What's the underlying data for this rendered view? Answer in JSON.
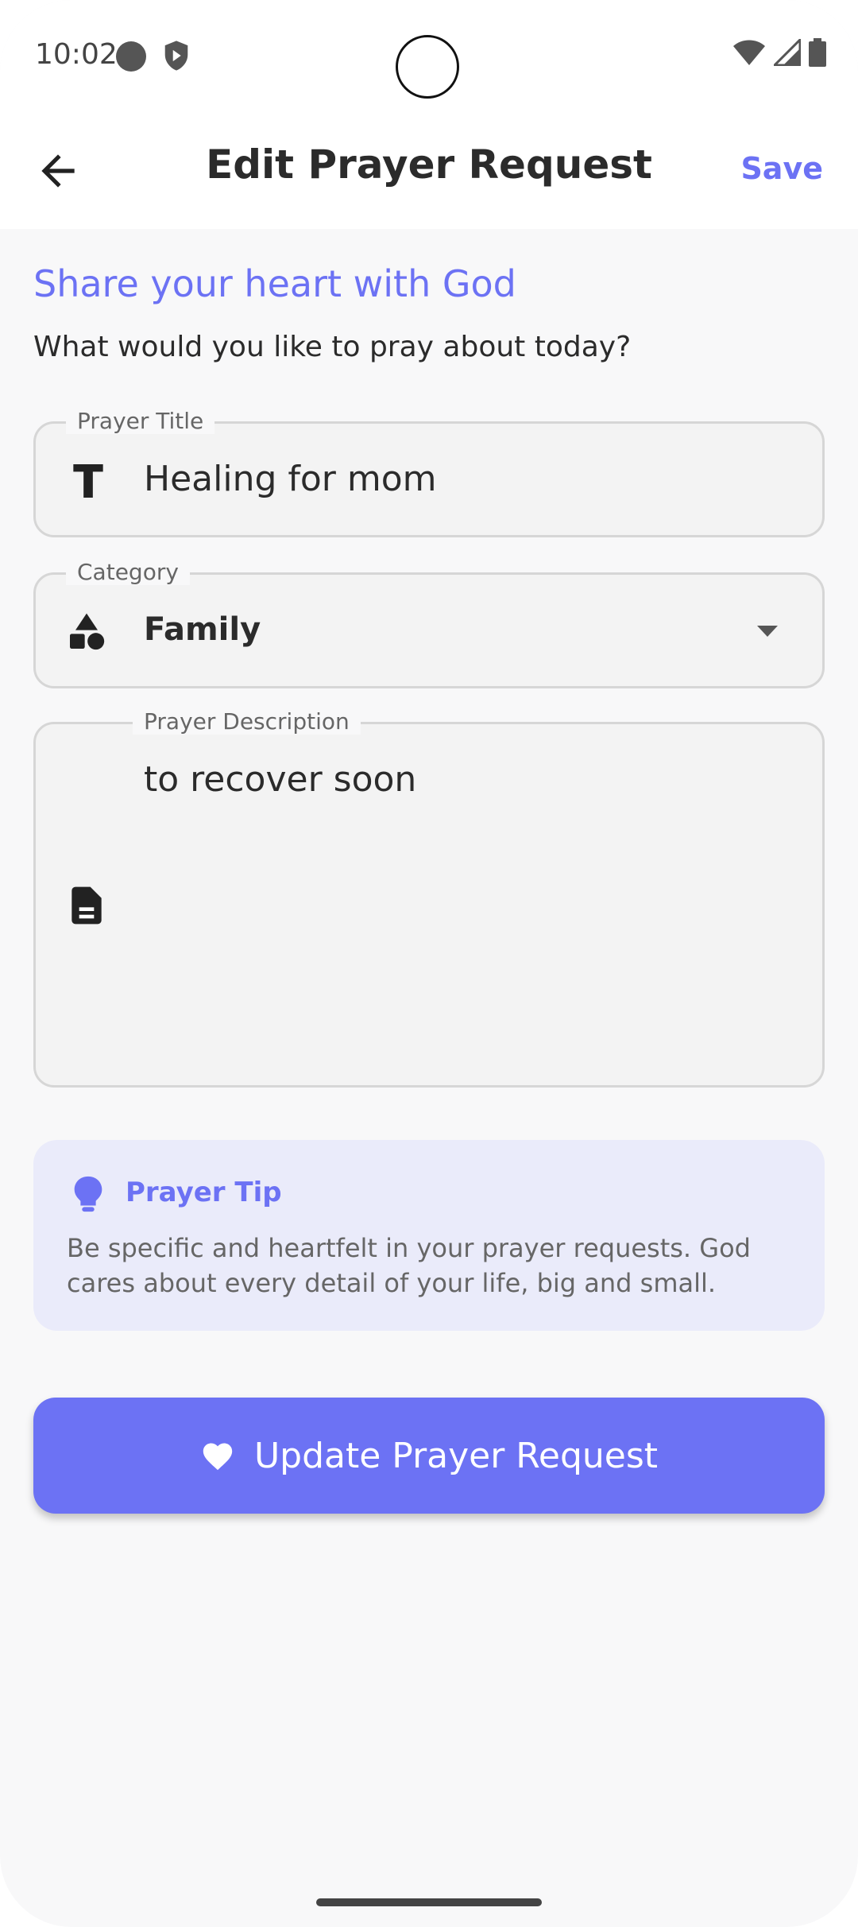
{
  "status": {
    "time": "10:02"
  },
  "appbar": {
    "title": "Edit Prayer Request",
    "save_label": "Save"
  },
  "intro": {
    "heading": "Share your heart with God",
    "subheading": "What would you like to pray about today?"
  },
  "form": {
    "title_field": {
      "label": "Prayer Title",
      "value": "Healing for mom"
    },
    "category_field": {
      "label": "Category",
      "value": "Family"
    },
    "description_field": {
      "label": "Prayer Description",
      "value": "to recover soon"
    }
  },
  "tip": {
    "title": "Prayer Tip",
    "text": "Be specific and heartfelt in your prayer requests. God cares about every detail of your life, big and small."
  },
  "submit": {
    "label": "Update Prayer Request"
  },
  "colors": {
    "accent": "#6c72f4",
    "tip_background": "#eaebfa",
    "background": "#f8f8f9"
  },
  "icons": [
    "back-arrow-icon",
    "text-format-icon",
    "category-shapes-icon",
    "dropdown-arrow-icon",
    "document-icon",
    "lightbulb-icon",
    "heart-icon",
    "wifi-icon",
    "signal-icon",
    "battery-icon",
    "shield-icon"
  ]
}
